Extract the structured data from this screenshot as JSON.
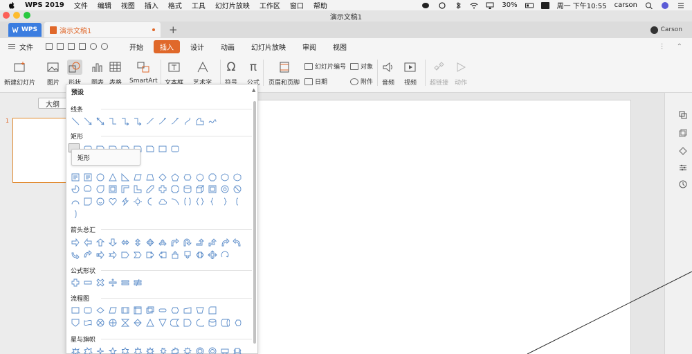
{
  "menubar": {
    "app_name": "WPS 2019",
    "items": [
      "文件",
      "编辑",
      "视图",
      "插入",
      "格式",
      "工具",
      "幻灯片放映",
      "工作区",
      "窗口",
      "帮助"
    ],
    "battery": "30%",
    "datetime": "周一 下午10:55",
    "user": "carson"
  },
  "window": {
    "title": "演示文稿1"
  },
  "tabs": {
    "wps_label": "WPS",
    "doc_label": "演示文稿1",
    "add": "+",
    "user": "Carson"
  },
  "toolbar": {
    "file_label": "文件",
    "menu_tabs": [
      "开始",
      "插入",
      "设计",
      "动画",
      "幻灯片放映",
      "审阅",
      "视图"
    ],
    "active_tab": "插入"
  },
  "ribbon": {
    "new_slide": "新建幻灯片",
    "picture": "图片",
    "shape": "形状",
    "chart": "图表",
    "table": "表格",
    "smartart": "SmartArt",
    "textbox": "文本框",
    "wordart": "艺术字",
    "symbol": "符号",
    "formula": "公式",
    "header_footer": "页眉和页脚",
    "slide_number": "幻灯片编号",
    "object": "对象",
    "date": "日期",
    "attachment": "附件",
    "audio": "音频",
    "video": "视频",
    "hyperlink": "超链接",
    "action": "动作"
  },
  "left_pane": {
    "outline": "大纲",
    "slide_number": "1"
  },
  "shape_popup": {
    "header": "预设",
    "sections": {
      "lines": "线条",
      "rect": "矩形",
      "basic": "",
      "arrows": "箭头总汇",
      "formula": "公式形状",
      "flowchart": "流程图",
      "stars": "星与旗帜"
    },
    "tooltip": "矩形"
  },
  "colors": {
    "accent": "#e0682a",
    "wps_blue": "#3b7de0",
    "shape_stroke": "#5b8cc9"
  }
}
